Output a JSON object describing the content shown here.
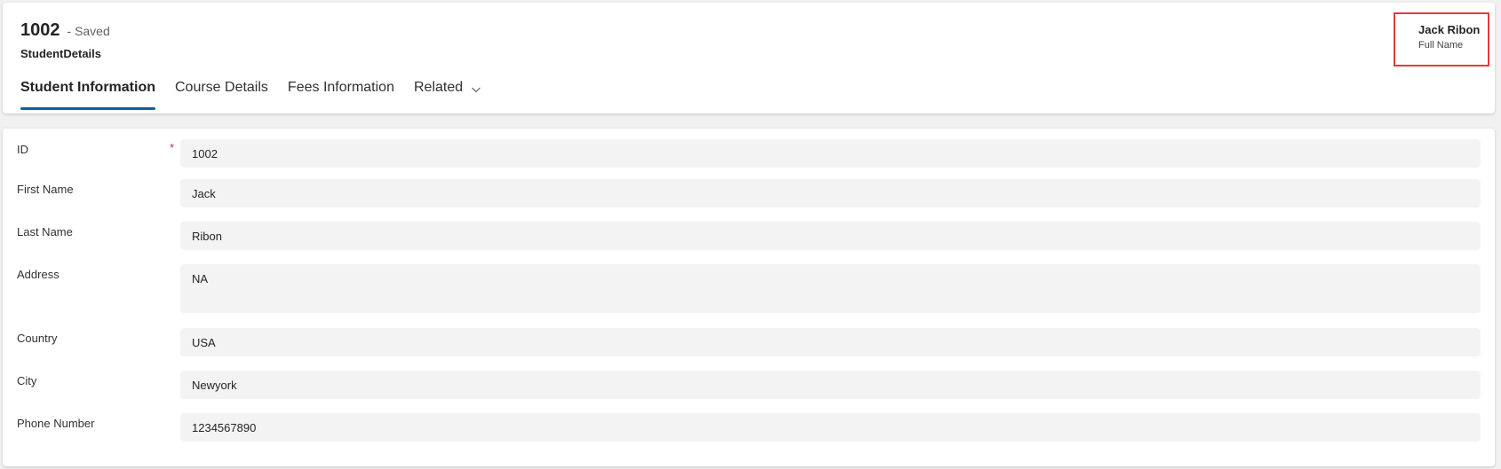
{
  "record": {
    "title": "1002",
    "status": "- Saved",
    "entity": "StudentDetails"
  },
  "tabs": [
    {
      "label": "Student Information",
      "active": true
    },
    {
      "label": "Course Details",
      "active": false
    },
    {
      "label": "Fees Information",
      "active": false
    },
    {
      "label": "Related",
      "active": false,
      "icon": "chevron-down-icon"
    }
  ],
  "header_field": {
    "value": "Jack Ribon",
    "label": "Full Name"
  },
  "form": {
    "fields": [
      {
        "label": "ID",
        "value": "1002",
        "required": true
      },
      {
        "label": "First Name",
        "value": "Jack"
      },
      {
        "label": "Last Name",
        "value": "Ribon"
      },
      {
        "label": "Address",
        "value": "NA",
        "multiline": true
      },
      {
        "label": "Country",
        "value": "USA"
      },
      {
        "label": "City",
        "value": "Newyork"
      },
      {
        "label": "Phone Number",
        "value": "1234567890"
      }
    ],
    "required_marker": "*"
  },
  "colors": {
    "accent": "#115ea3",
    "highlight_border": "#e03a3e",
    "required": "#c4314b",
    "input_bg": "#f3f3f3"
  }
}
